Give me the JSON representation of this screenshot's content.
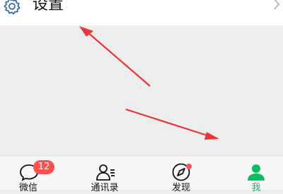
{
  "settings": {
    "label": "设置",
    "icon": "gear-icon",
    "chevron": "chevron-right-icon"
  },
  "tabbar": {
    "tabs": [
      {
        "label": "微信",
        "icon": "chat-bubble-icon",
        "badge": "12",
        "active": false
      },
      {
        "label": "通讯录",
        "icon": "contacts-icon",
        "active": false
      },
      {
        "label": "发现",
        "icon": "compass-icon",
        "dot": true,
        "active": false
      },
      {
        "label": "我",
        "icon": "profile-icon",
        "active": true
      }
    ]
  },
  "colors": {
    "accent": "#07c160",
    "badge": "#fa5151",
    "annotation_arrow": "#e8343a",
    "background": "#ededed"
  }
}
